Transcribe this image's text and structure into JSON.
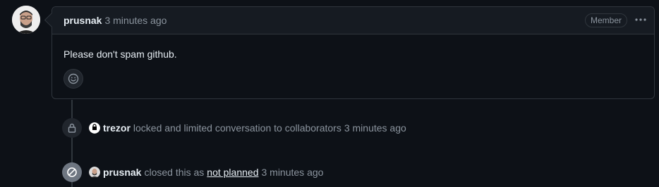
{
  "comment": {
    "author": "prusnak",
    "time": "3 minutes ago",
    "badge": "Member",
    "body": "Please don't spam github."
  },
  "events": [
    {
      "actor": "trezor",
      "action": "locked and limited conversation to collaborators",
      "time": "3 minutes ago",
      "icon": "lock-icon"
    },
    {
      "actor": "prusnak",
      "action_before": "closed this as",
      "link": "not planned",
      "time": "3 minutes ago",
      "icon": "skip-icon"
    }
  ],
  "colors": {
    "background": "#0d1117",
    "border": "#30363d",
    "muted": "#8b949e",
    "text": "#e6edf3"
  }
}
